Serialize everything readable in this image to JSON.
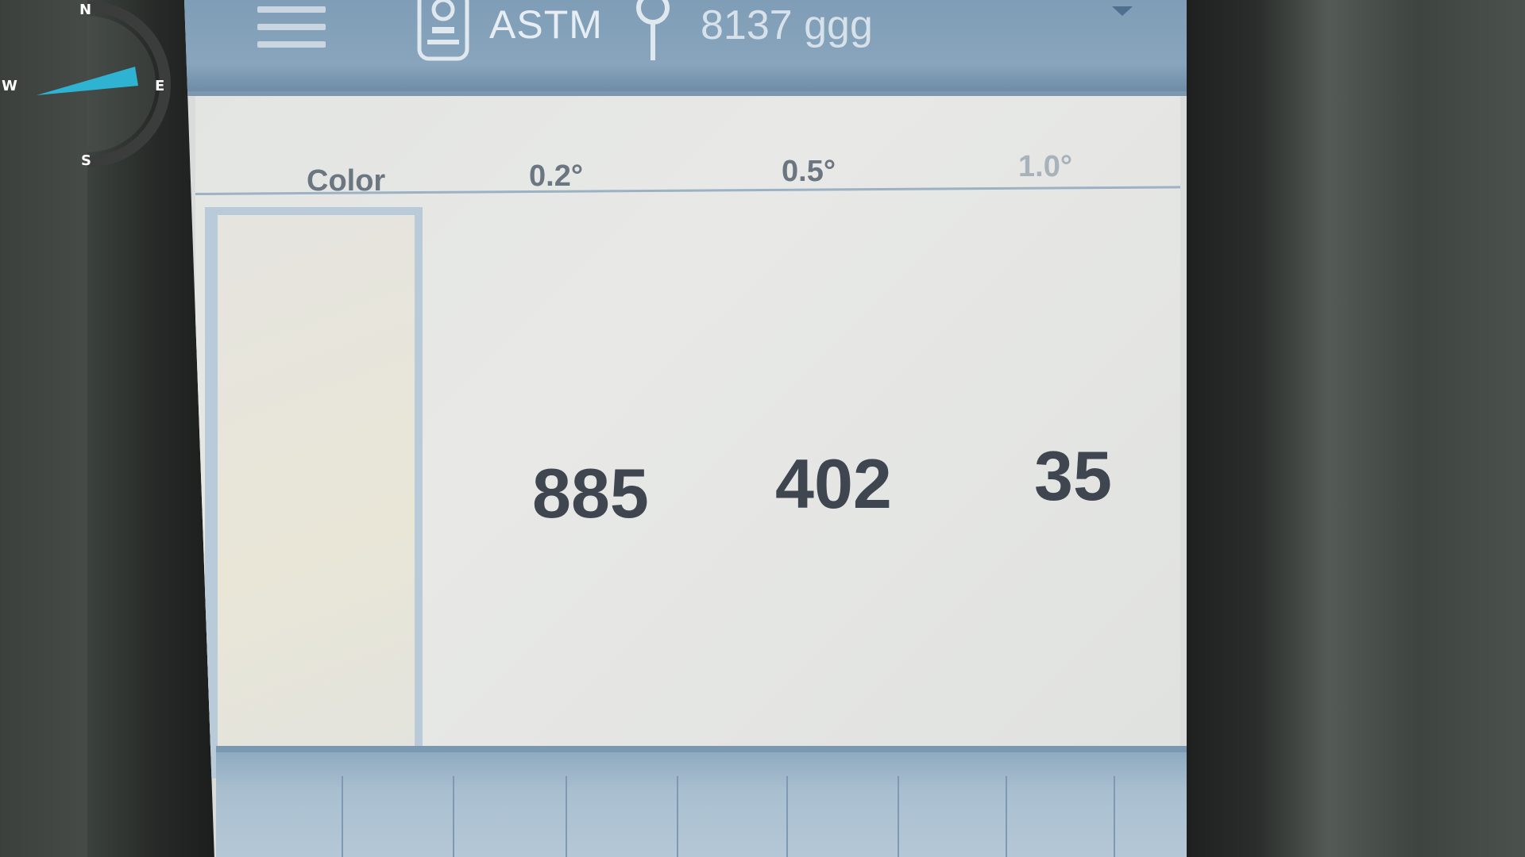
{
  "header": {
    "standard": "ASTM",
    "location": "8137 ggg",
    "menu_icon": "hamburger-menu-icon",
    "device_icon": "retroreflectometer-device-icon",
    "pin_icon": "location-pin-icon",
    "dropdown_icon": "chevron-down-icon"
  },
  "table": {
    "columns": [
      "Color",
      "0.2°",
      "0.5°",
      "1.0°"
    ],
    "values": [
      "885",
      "402",
      "35"
    ]
  },
  "compass": {
    "north": "N",
    "south": "S",
    "east": "E",
    "west": "W",
    "needle_color": "#2fb3d3"
  },
  "colors": {
    "header_bg": "#86a3bb",
    "accent_border": "#b9cbd9",
    "value_text": "#3f4650"
  }
}
